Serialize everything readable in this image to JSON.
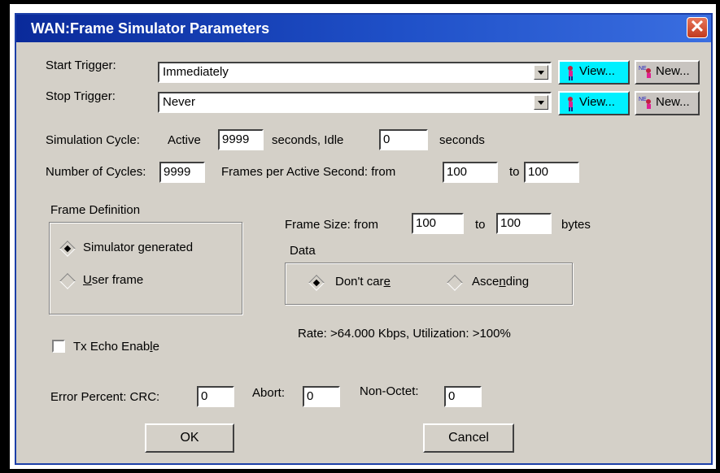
{
  "window": {
    "title": "WAN:Frame Simulator Parameters",
    "close_glyph": "✕"
  },
  "triggers": {
    "start_label": "Start Trigger:",
    "start_value": "Immediately",
    "stop_label": "Stop Trigger:",
    "stop_value": "Never",
    "view_label": "View...",
    "new_label": "New..."
  },
  "cycle": {
    "label": "Simulation Cycle:",
    "active_label": "Active",
    "active_value": "9999",
    "seconds_idle_label": "seconds,  Idle",
    "idle_value": "0",
    "seconds_label": "seconds"
  },
  "cycles": {
    "label": "Number of Cycles:",
    "value": "9999",
    "fps_label": "Frames per Active Second: from",
    "fps_from": "100",
    "to_label": "to",
    "fps_to": "100"
  },
  "frame_definition": {
    "title": "Frame Definition",
    "opt_simulator": "Simulator generated",
    "opt_user_u": "U",
    "opt_user_rest": "ser frame"
  },
  "frame_size": {
    "label": "Frame Size:  from",
    "from": "100",
    "to_label": "to",
    "to": "100",
    "unit": "bytes"
  },
  "data_group": {
    "title": "Data",
    "dont_care_a": "Don't car",
    "dont_care_u": "e",
    "ascending_a": "Asce",
    "ascending_u": "n",
    "ascending_b": "ding"
  },
  "rate_text": "Rate: >64.000 Kbps, Utilization: >100%",
  "tx_echo": {
    "label_a": "Tx Echo Enab",
    "label_u": "l",
    "label_b": "e"
  },
  "errors": {
    "label": "Error Percent:  CRC:",
    "crc": "0",
    "abort_label": "Abort:",
    "abort": "0",
    "nonoctet_label": "Non-Octet:",
    "nonoctet": "0"
  },
  "buttons": {
    "ok": "OK",
    "cancel": "Cancel"
  },
  "colors": {
    "title_bar": "#1f50c8",
    "view_button": "#00f0ff",
    "face": "#d4d0c8"
  }
}
